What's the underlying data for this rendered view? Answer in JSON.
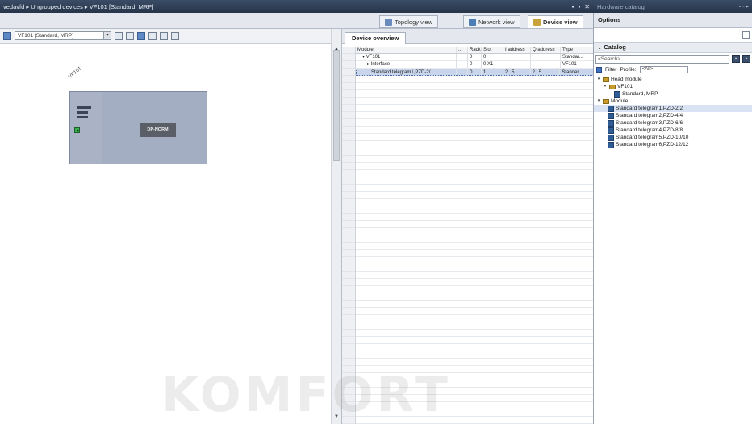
{
  "titlebar": {
    "breadcrumb": "vedavfd ▸ Ungrouped devices ▸ VF101 [Standard, MRP]",
    "window_controls": "_ ▪ ▪ ✕"
  },
  "views": {
    "topology": "Topology view",
    "network": "Network view",
    "device": "Device view",
    "active": "Device view"
  },
  "canvas": {
    "device_selector": "VF101 [Standard, MRP]",
    "device_label": "VF101",
    "module_label": "DP-NORM"
  },
  "overview": {
    "tab": "Device overview",
    "columns": [
      "Module",
      "...",
      "Rack",
      "Slot",
      "I address",
      "Q address",
      "Type"
    ],
    "rows": [
      {
        "module": "▾ VF101",
        "rack": "0",
        "slot": "0",
        "i_addr": "",
        "q_addr": "",
        "type": "Standar..."
      },
      {
        "module": "▸ Interface",
        "rack": "0",
        "slot": "0 X1",
        "i_addr": "",
        "q_addr": "",
        "type": "VF101"
      },
      {
        "module": "Standard telegram1,PZD-2/...",
        "rack": "0",
        "slot": "1",
        "i_addr": "2...5",
        "q_addr": "2...5",
        "type": "Stander..."
      }
    ]
  },
  "hardware_catalog": {
    "title": "Hardware catalog",
    "options": "Options",
    "catalog": "Catalog",
    "search_placeholder": "<Search>",
    "filter": "Filter",
    "profile_label": "Profile:",
    "profile_value": "<All>",
    "tree": {
      "head_module": "Head module",
      "vf101": "VF101",
      "standard_mrp": "Standard, MRP",
      "module": "Module",
      "telegrams": [
        "Standard telegram1,PZD-2/2",
        "Standard telegram2,PZD-4/4",
        "Standard telegram3,PZD-6/6",
        "Standard telegram4,PZD-8/8",
        "Standard telegram5,PZD-10/10",
        "Standard telegram6,PZD-12/12"
      ]
    }
  },
  "watermark": "KOMFORT",
  "colors": {
    "title_bar": "#2f3f58",
    "device_body": "#a4aec2",
    "port_green": "#35b04a",
    "selection": "#c9d5ea"
  }
}
